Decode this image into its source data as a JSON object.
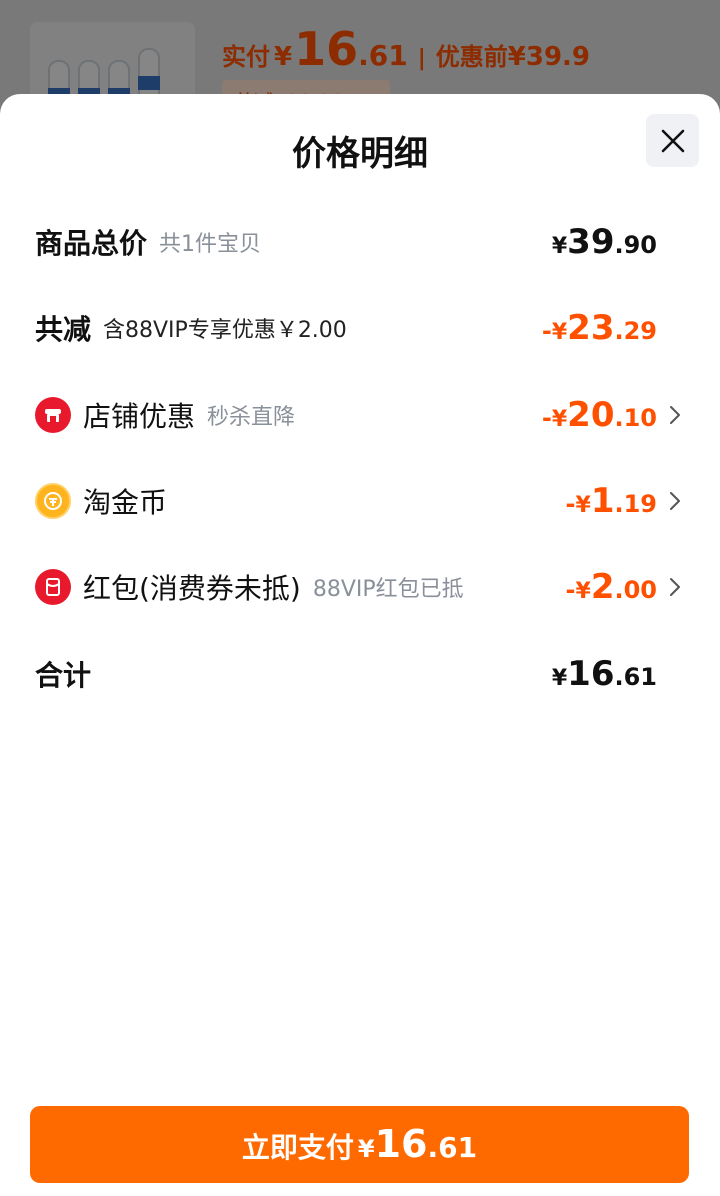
{
  "background": {
    "price_prefix": "实付",
    "currency": "¥",
    "price_int": "16",
    "price_dec": ".61",
    "separator": "|",
    "before_label": "优惠前",
    "before_price": "¥39.9",
    "tag_text": "共减¥23.29"
  },
  "sheet": {
    "title": "价格明细",
    "close_icon": "close-icon"
  },
  "rows": {
    "total_price": {
      "label": "商品总价",
      "sub": "共1件宝贝",
      "currency": "¥",
      "int": "39",
      "dec": ".90"
    },
    "reduction": {
      "label": "共减",
      "sub": "含88VIP专享优惠￥2.00",
      "sign": "-",
      "currency": "¥",
      "int": "23",
      "dec": ".29"
    },
    "shop_discount": {
      "icon": "shop-icon",
      "label": "店铺优惠",
      "sub": "秒杀直降",
      "sign": "-",
      "currency": "¥",
      "int": "20",
      "dec": ".10"
    },
    "coins": {
      "icon": "coin-icon",
      "label": "淘金币",
      "sign": "-",
      "currency": "¥",
      "int": "1",
      "dec": ".19"
    },
    "red_packet": {
      "icon": "red-packet-icon",
      "label": "红包(消费券未抵)",
      "sub": "88VIP红包已抵",
      "sign": "-",
      "currency": "¥",
      "int": "2",
      "dec": ".00"
    },
    "sum": {
      "label": "合计",
      "currency": "¥",
      "int": "16",
      "dec": ".61"
    }
  },
  "pay_button": {
    "label": "立即支付",
    "currency": "¥",
    "int": "16",
    "dec": ".61"
  },
  "colors": {
    "accent": "#ff5000",
    "button": "#ff6a00",
    "text": "#111111",
    "subtext": "#8a9099"
  }
}
